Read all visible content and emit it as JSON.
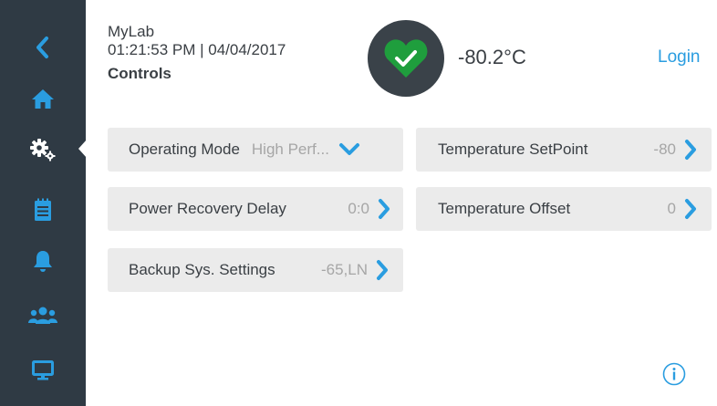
{
  "header": {
    "title": "MyLab",
    "datetime": "01:21:53 PM | 04/04/2017",
    "section": "Controls",
    "temperature": "-80.2°C",
    "login_label": "Login",
    "status_icon": "heart-check-icon",
    "status_color": "#1f9e3d"
  },
  "sidebar": {
    "items": [
      {
        "icon": "back-chevron-icon"
      },
      {
        "icon": "home-icon"
      },
      {
        "icon": "gear-icon",
        "active": true
      },
      {
        "icon": "clipboard-icon"
      },
      {
        "icon": "bell-icon"
      },
      {
        "icon": "users-icon"
      },
      {
        "icon": "monitor-icon"
      }
    ]
  },
  "controls": {
    "operating_mode": {
      "label": "Operating Mode",
      "value": "High Perf..."
    },
    "temperature_setpoint": {
      "label": "Temperature SetPoint",
      "value": "-80"
    },
    "power_recovery_delay": {
      "label": "Power Recovery Delay",
      "value": "0:0"
    },
    "temperature_offset": {
      "label": "Temperature Offset",
      "value": "0"
    },
    "backup_sys_settings": {
      "label": "Backup Sys. Settings",
      "value": "-65,LN"
    }
  },
  "colors": {
    "accent": "#2a9de0",
    "sidebar_bg": "#2f3a44",
    "tile_bg": "#ebebeb"
  }
}
